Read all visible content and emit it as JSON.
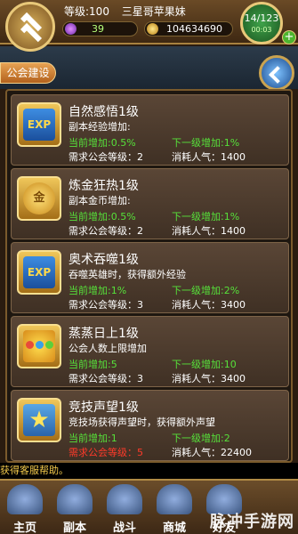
{
  "topbar": {
    "level": "等级:100",
    "player_name": "三星哥苹果妹",
    "gems": "39",
    "gold": "104634690",
    "stamina": "14/123",
    "stamina_timer": "00:03",
    "add_label": "+"
  },
  "header": {
    "tab_label": "公会建设"
  },
  "items": [
    {
      "title": "自然感悟1级",
      "desc": "副本经验增加:",
      "current": "当前增加:0.5%",
      "next": "下一级增加:1%",
      "requirement": "需求公会等级：2",
      "cost": "消耗人气：1400",
      "icon": "exp-icon",
      "icon_text": "EXP"
    },
    {
      "title": "炼金狂热1级",
      "desc": "副本金币增加:",
      "current": "当前增加:0.5%",
      "next": "下一级增加:1%",
      "requirement": "需求公会等级：2",
      "cost": "消耗人气：1400",
      "icon": "gold-coin-icon",
      "icon_text": "金"
    },
    {
      "title": "奥术吞噬1级",
      "desc": "吞噬英雄时，获得额外经验",
      "current": "当前增加:1%",
      "next": "下一级增加:2%",
      "requirement": "需求公会等级：3",
      "cost": "消耗人气：3400",
      "icon": "exp-icon",
      "icon_text": "EXP"
    },
    {
      "title": "蒸蒸日上1级",
      "desc": "公会人数上限增加",
      "current": "当前增加:5",
      "next": "下一级增加:10",
      "requirement": "需求公会等级：3",
      "cost": "消耗人气：3400",
      "icon": "members-icon",
      "icon_text": ""
    },
    {
      "title": "竞技声望1级",
      "desc": "竞技场获得声望时，获得额外声望",
      "current": "当前增加:1",
      "next": "下一级增加:2",
      "requirement": "需求公会等级：5",
      "cost": "消耗人气：22400",
      "icon": "star-icon",
      "icon_text": "★"
    }
  ],
  "ticker": "获得客服帮助。",
  "nav": [
    {
      "label": "主页",
      "icon": "home-icon"
    },
    {
      "label": "副本",
      "icon": "dungeon-icon"
    },
    {
      "label": "战斗",
      "icon": "battle-icon"
    },
    {
      "label": "商城",
      "icon": "shop-icon"
    },
    {
      "label": "好友",
      "icon": "friends-icon"
    }
  ],
  "watermark": "脉冲手游网",
  "colors": {
    "green_text": "#56e03a",
    "red_text": "#ff3a2a",
    "gold_border": "#e8c879"
  }
}
